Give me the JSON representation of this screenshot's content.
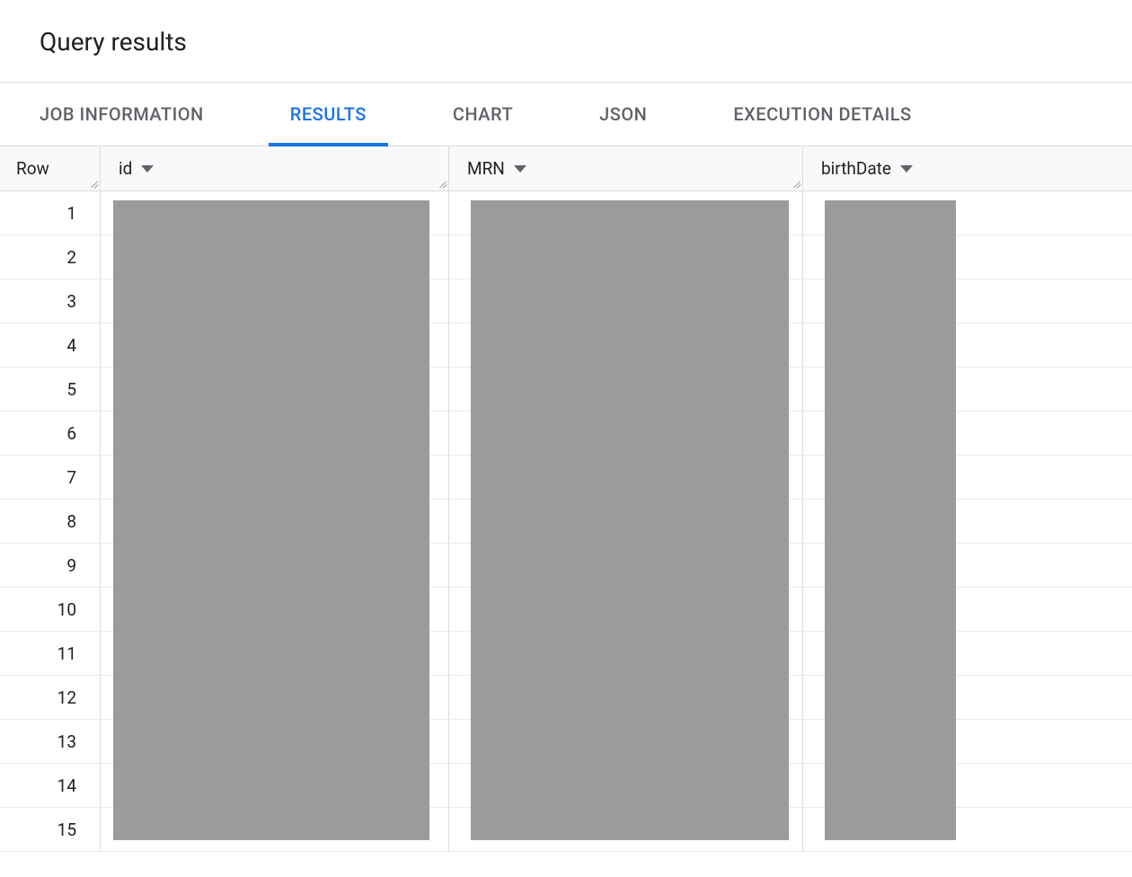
{
  "header": {
    "title": "Query results"
  },
  "tabs": [
    {
      "label": "JOB INFORMATION",
      "active": false
    },
    {
      "label": "RESULTS",
      "active": true
    },
    {
      "label": "CHART",
      "active": false
    },
    {
      "label": "JSON",
      "active": false
    },
    {
      "label": "EXECUTION DETAILS",
      "active": false
    }
  ],
  "table": {
    "columns": {
      "row": "Row",
      "id": "id",
      "mrn": "MRN",
      "birthdate": "birthDate"
    },
    "rows": [
      {
        "num": "1"
      },
      {
        "num": "2"
      },
      {
        "num": "3"
      },
      {
        "num": "4"
      },
      {
        "num": "5"
      },
      {
        "num": "6"
      },
      {
        "num": "7"
      },
      {
        "num": "8"
      },
      {
        "num": "9"
      },
      {
        "num": "10"
      },
      {
        "num": "11"
      },
      {
        "num": "12"
      },
      {
        "num": "13"
      },
      {
        "num": "14"
      },
      {
        "num": "15"
      }
    ]
  }
}
